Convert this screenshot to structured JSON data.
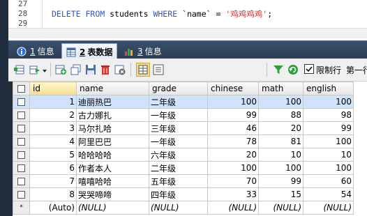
{
  "editor": {
    "lines": [
      {
        "num": "27",
        "code": ""
      },
      {
        "num": "28",
        "code": "DELETE FROM students WHERE `name` = '鸡鸡鸡鸡';"
      },
      {
        "num": "29",
        "code": ""
      }
    ],
    "sql_kw1": "DELETE",
    "sql_kw2": "FROM",
    "sql_table": "students",
    "sql_kw3": "WHERE",
    "sql_col": "`name`",
    "sql_eq": "=",
    "sql_str": "'鸡鸡鸡鸡'",
    "sql_end": ";"
  },
  "tabs": [
    {
      "num": "1",
      "label": "信息",
      "icon": "info-icon"
    },
    {
      "num": "2",
      "label": "表数据",
      "icon": "table-icon"
    },
    {
      "num": "3",
      "label": "信息",
      "icon": "chart-icon"
    }
  ],
  "toolbar": {
    "limit_rows_label": "限制行",
    "first_row_label": "第一行:"
  },
  "grid": {
    "columns": [
      "id",
      "name",
      "grade",
      "chinese",
      "math",
      "english"
    ],
    "rows": [
      {
        "id": "1",
        "name": "迪丽热巴",
        "grade": "二年级",
        "chinese": "100",
        "math": "100",
        "english": "100"
      },
      {
        "id": "2",
        "name": "古力娜扎",
        "grade": "一年级",
        "chinese": "99",
        "math": "88",
        "english": "98"
      },
      {
        "id": "3",
        "name": "马尔扎哈",
        "grade": "三年级",
        "chinese": "46",
        "math": "20",
        "english": "99"
      },
      {
        "id": "4",
        "name": "阿里巴巴",
        "grade": "一年级",
        "chinese": "78",
        "math": "81",
        "english": "100"
      },
      {
        "id": "5",
        "name": "哈哈哈哈",
        "grade": "六年级",
        "chinese": "20",
        "math": "10",
        "english": "10"
      },
      {
        "id": "6",
        "name": "作者本人",
        "grade": "二年级",
        "chinese": "100",
        "math": "100",
        "english": "100"
      },
      {
        "id": "7",
        "name": "嘻嘻哈哈",
        "grade": "五年级",
        "chinese": "70",
        "math": "99",
        "english": "60"
      },
      {
        "id": "8",
        "name": "哭哭啼啼",
        "grade": "四年级",
        "chinese": "33",
        "math": "15",
        "english": "54"
      }
    ],
    "new_row": {
      "marker": "*",
      "id": "(Auto)",
      "null_text": "(NULL)"
    }
  },
  "colors": {
    "selected_row": "#d1e2fb",
    "keyword": "#3a52c9",
    "string": "#d92b2b",
    "frame": "#1f2d3f"
  }
}
